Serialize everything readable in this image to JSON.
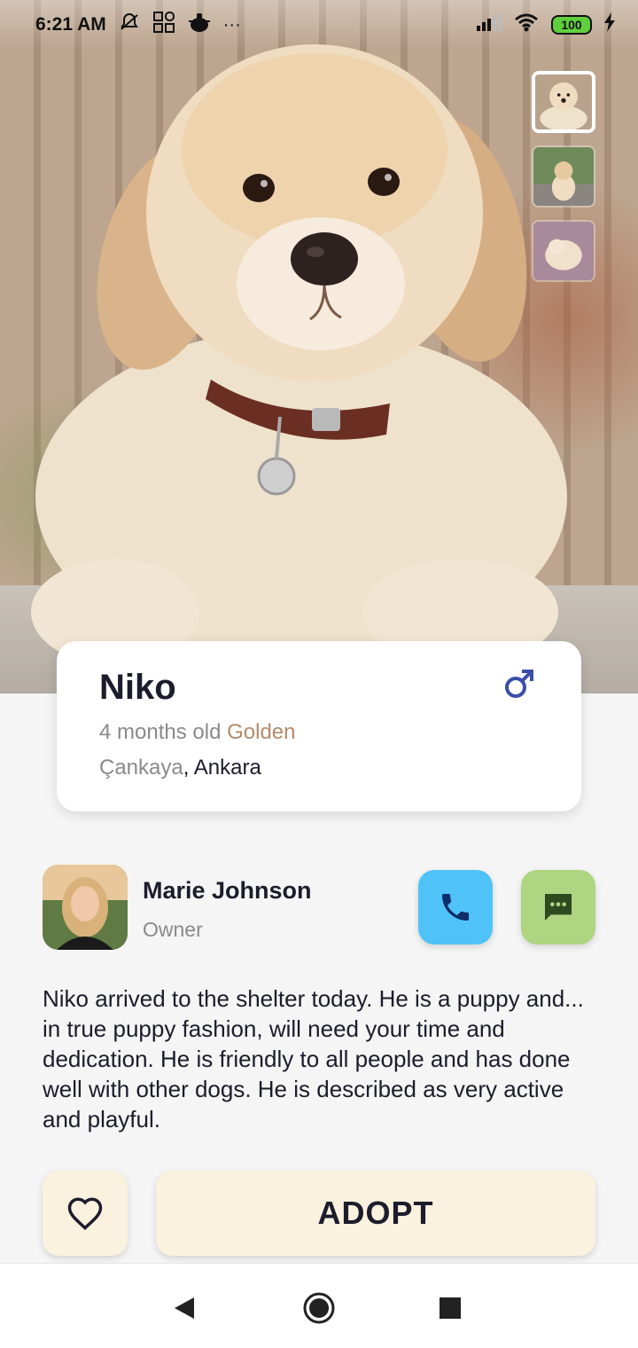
{
  "status_bar": {
    "time": "6:21 AM",
    "icons_left": [
      "notifications-off-icon",
      "grid-icon",
      "pot-icon"
    ],
    "more": "···",
    "battery": "100",
    "icons_right": [
      "signal-icon",
      "wifi-icon",
      "battery-icon",
      "charging-icon"
    ]
  },
  "gallery": {
    "thumbnails": [
      "puppy-photo-1",
      "puppy-photo-2",
      "puppy-photo-3"
    ],
    "active_index": 0
  },
  "pet": {
    "name": "Niko",
    "age": "4 months old",
    "breed": "Golden",
    "district": "Çankaya",
    "separator": ", ",
    "city": "Ankara",
    "gender_icon": "male-icon"
  },
  "owner": {
    "name": "Marie Johnson",
    "role": "Owner"
  },
  "description": "Niko arrived to the shelter today. He is a puppy and... in true puppy fashion, will need your time and dedication. He is friendly to all people and has done well with other dogs. He is described as very active and playful.",
  "actions": {
    "adopt_label": "ADOPT",
    "favorite_icon": "heart-outline-icon",
    "call_icon": "phone-icon",
    "message_icon": "chat-icon"
  },
  "colors": {
    "call_button": "#4fc3f7",
    "message_button": "#aed581",
    "adopt_button": "#faf1de",
    "breed_text": "#b58a6a",
    "gender_icon": "#3b4ea8"
  },
  "nav": [
    "back-icon",
    "home-icon",
    "recents-icon"
  ]
}
